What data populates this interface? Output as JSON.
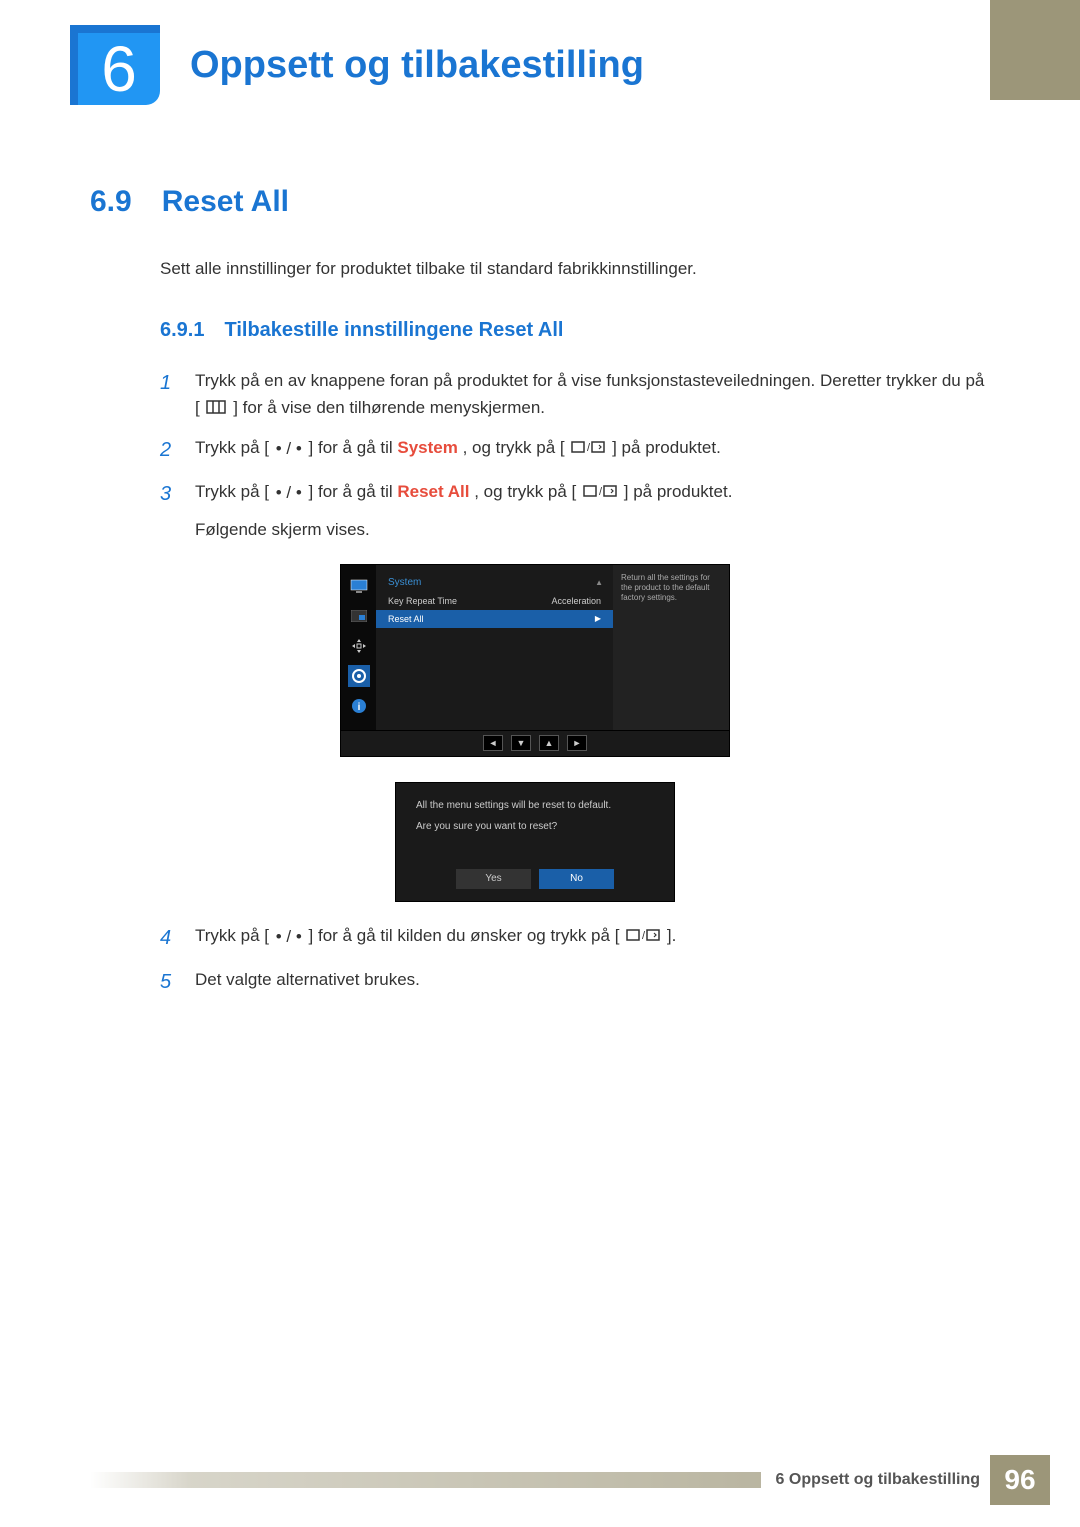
{
  "chapter": {
    "number": "6",
    "title": "Oppsett og tilbakestilling"
  },
  "section": {
    "number": "6.9",
    "title": "Reset All",
    "intro": "Sett alle innstillinger for produktet tilbake til standard fabrikkinnstillinger."
  },
  "subsection": {
    "number": "6.9.1",
    "title": "Tilbakestille innstillingene Reset All"
  },
  "steps": {
    "s1": {
      "num": "1",
      "text_a": "Trykk på en av knappene foran på produktet for å vise funksjonstasteveiledningen. Deretter trykker du på [",
      "text_b": "] for å vise den tilhørende menyskjermen."
    },
    "s2": {
      "num": "2",
      "text_a": "Trykk på [",
      "text_b": "] for å gå til ",
      "highlight": "System",
      "text_c": ", og trykk på [",
      "text_d": "] på produktet."
    },
    "s3": {
      "num": "3",
      "text_a": "Trykk på [",
      "text_b": "] for å gå til ",
      "highlight": "Reset All",
      "text_c": ", og trykk på [",
      "text_d": "] på produktet.",
      "followup": "Følgende skjerm vises."
    },
    "s4": {
      "num": "4",
      "text_a": "Trykk på [",
      "text_b": "] for å gå til kilden du ønsker og trykk på [",
      "text_c": "]."
    },
    "s5": {
      "num": "5",
      "text": "Det valgte alternativet brukes."
    }
  },
  "osd": {
    "title": "System",
    "item1_label": "Key Repeat Time",
    "item1_value": "Acceleration",
    "item2_label": "Reset All",
    "help": "Return all the settings for the product to the default factory settings.",
    "nav_up_arrow": "▲"
  },
  "dialog": {
    "line1": "All the menu settings will be reset to default.",
    "line2": "Are you sure you want to reset?",
    "yes": "Yes",
    "no": "No"
  },
  "footer": {
    "text": "6 Oppsett og tilbakestilling",
    "page": "96"
  }
}
